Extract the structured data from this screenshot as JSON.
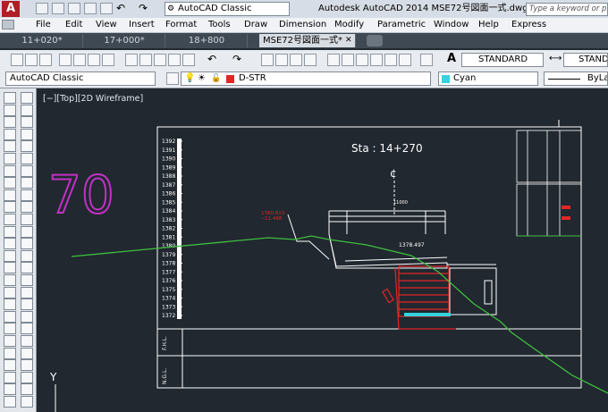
{
  "titlebar": {
    "app_logo": "A",
    "workspace": "AutoCAD Classic",
    "title": "Autodesk AutoCAD 2014    MSE72号図面一式.dwg",
    "search_placeholder": "Type a keyword or phrase"
  },
  "menu": [
    "File",
    "Edit",
    "View",
    "Insert",
    "Format",
    "Tools",
    "Draw",
    "Dimension",
    "Modify",
    "Parametric",
    "Window",
    "Help",
    "Express"
  ],
  "tabs": [
    {
      "label": "11+020*",
      "active": false
    },
    {
      "label": "17+000*",
      "active": false
    },
    {
      "label": "18+800",
      "active": false
    },
    {
      "label": "MSE72号図面一式*",
      "active": true
    }
  ],
  "toolbar": {
    "text_style": "STANDARD",
    "dim_style": "STANDARD",
    "workspace_combo": "AutoCAD Classic",
    "layer": "D-STR",
    "color": "Cyan",
    "linetype": "ByLa",
    "colors": {
      "layer_swatch": "#e32626",
      "cyan_swatch": "#34d3df"
    }
  },
  "viewport": {
    "label": "[−][Top][2D Wireframe]",
    "ucs_y": "Y",
    "big_number": "70",
    "station_title": "Sta  :  14+270",
    "center_mark": "¢",
    "elevations": [
      "1392",
      "1391",
      "1390",
      "1389",
      "1388",
      "1387",
      "1386",
      "1385",
      "1384",
      "1383",
      "1382",
      "1381",
      "1380",
      "1379",
      "1378",
      "1377",
      "1376",
      "1375",
      "1374",
      "1373",
      "1372"
    ],
    "red_label_1": "1380.813",
    "red_label_2": "--11.488",
    "level_value": "1378.497",
    "dim_value": "11000",
    "row_label_1": "F.H.L.",
    "row_label_2": "N.G.L.",
    "colors": {
      "background": "#212830",
      "magenta": "#c231c4",
      "ground_line": "#3fbf3f",
      "red_structure": "#e32626",
      "white_lines": "#ffffff"
    }
  }
}
